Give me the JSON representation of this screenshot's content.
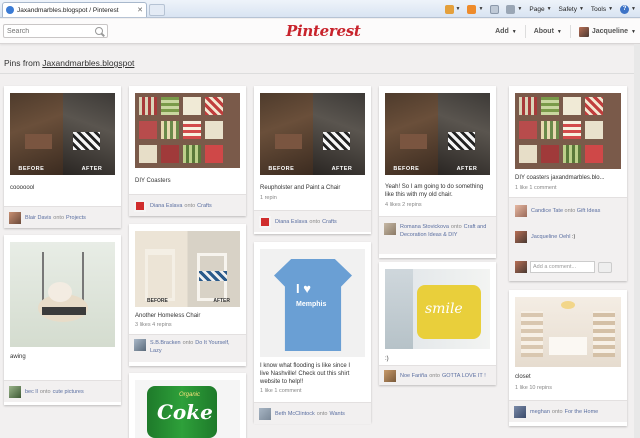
{
  "browser": {
    "tab_title": "Jaxandmarbles.blogspot / Pinterest",
    "toolbar": {
      "page_label": "Page",
      "safety_label": "Safety",
      "tools_label": "Tools"
    }
  },
  "header": {
    "logo": "Pinterest",
    "search_placeholder": "Search",
    "nav": {
      "add": "Add",
      "about": "About",
      "user": "Jacqueline"
    }
  },
  "page": {
    "title_prefix": "Pins from ",
    "board": "Jaxandmarbles.blogspot"
  },
  "pins": [
    {
      "desc": "cooooool",
      "user": "Blair Davis",
      "onto": "onto",
      "board": "Projects"
    },
    {
      "desc": "awing",
      "user": "bec ll",
      "onto": "onto",
      "board": "cute pictures"
    },
    {
      "desc": "DIY Coasters",
      "user": "Diana Eslava",
      "onto": "onto",
      "board": "Crafts"
    },
    {
      "desc": "Another Homeless Chair",
      "stats": "3 likes   4 repins",
      "user": "S.B.Bracken",
      "onto": "onto",
      "board": "Do It Yourself, Lazy"
    },
    {
      "desc": "Reupholster and Paint a Chair",
      "stats": "1 repin",
      "user": "Diana Eslava",
      "onto": "onto",
      "board": "Crafts"
    },
    {
      "desc": "I know what flooding is like since I live Nashville! Check out this shirt website to help!!",
      "stats": "1 like   1 comment",
      "user": "Beth McClintock",
      "onto": "onto",
      "board": "Wants"
    },
    {
      "desc": "Yeah! So I am going to do something like this with my old chair.",
      "stats": "4 likes   2 repins",
      "user": "Romana Stovickova",
      "onto": "onto",
      "board": "Craft and Decoration Ideas & DIY"
    },
    {
      "desc": ":)",
      "user": "Noe Fariña",
      "onto": "onto",
      "board": "GOTTA LOVE IT !"
    },
    {
      "desc": "DIY coasters jaxandmarbles.blo...",
      "stats": "1 like   1 comment",
      "user": "Candice Tate",
      "onto": "onto",
      "board": "Gift Ideas",
      "comment_user": "Jacqueline Oehl",
      "comment_text": ":)",
      "add_comment": "Add a comment..."
    },
    {
      "desc": "closet",
      "stats": "1 like   10 repins",
      "user": "meghan",
      "onto": "onto",
      "board": "For the Home"
    }
  ],
  "images": {
    "before": "BEFORE",
    "after": "AFTER",
    "shirt_top": "I ♥",
    "shirt_mid": "Memphis",
    "coke_brand": "Coke",
    "coke_sub": "Organic",
    "pillow": "smile"
  }
}
